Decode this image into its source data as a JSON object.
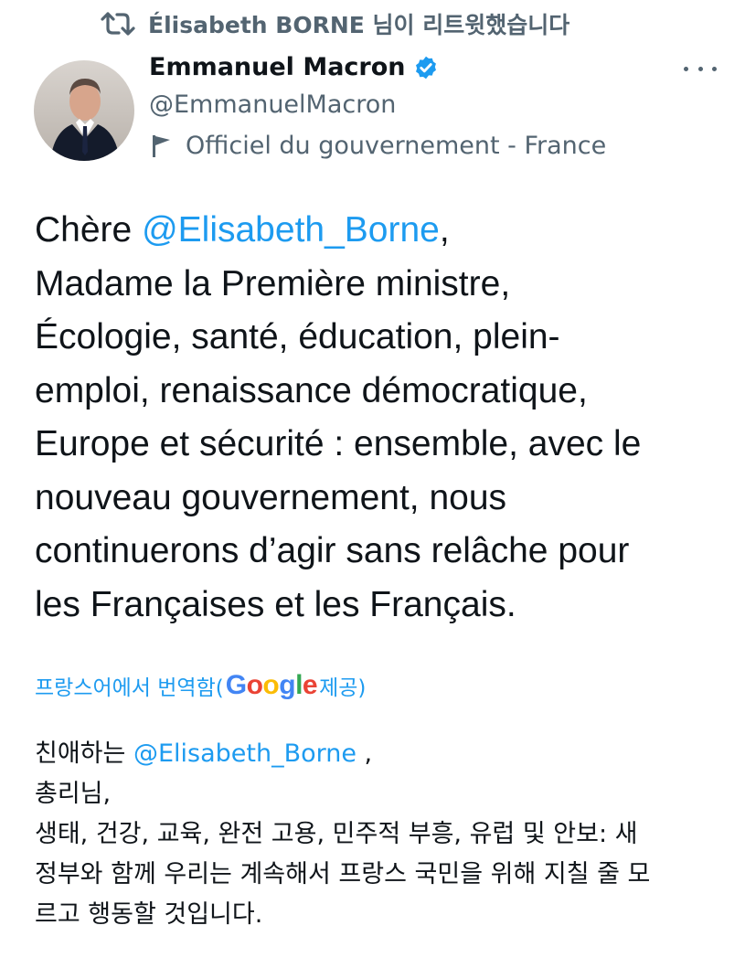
{
  "retweet": {
    "icon": "retweet-icon",
    "text": "Élisabeth BORNE 님이 리트윗했습니다"
  },
  "author": {
    "name": "Emmanuel Macron",
    "verified_icon": "verified-badge-icon",
    "handle": "@EmmanuelMacron",
    "label_icon": "government-flag-icon",
    "label": "Officiel du gouvernement - France"
  },
  "tweet": {
    "line1_prefix": "Chère ",
    "mention": "@Elisabeth_Borne",
    "line1_suffix": ",",
    "line2": "Madame la Première ministre,",
    "line3": "Écologie, santé, éducation, plein-",
    "line4": "emploi, renaissance démocratique,",
    "line5": "Europe et sécurité : ensemble, avec le",
    "line6": "nouveau gouvernement, nous",
    "line7": "continuerons d’agir sans relâche pour",
    "line8": "les Françaises et les Français."
  },
  "translation_notice": {
    "prefix": "프랑스어에서 번역함(",
    "provider": "Google",
    "suffix": " 제공)"
  },
  "translation": {
    "line1_prefix": "친애하는 ",
    "mention": "@Elisabeth_Borne",
    "line1_suffix": " ,",
    "line2": " 총리님,",
    "line3": " 생태, 건강, 교육, 완전 고용, 민주적 부흥, 유럽 및 안보: 새",
    "line4": "정부와 함께 우리는 계속해서 프랑스 국민을 위해 지칠 줄 모",
    "line5": "르고 행동할 것입니다."
  },
  "colors": {
    "link": "#1d9bf0",
    "secondary_text": "#536471",
    "primary_text": "#0f1419"
  }
}
